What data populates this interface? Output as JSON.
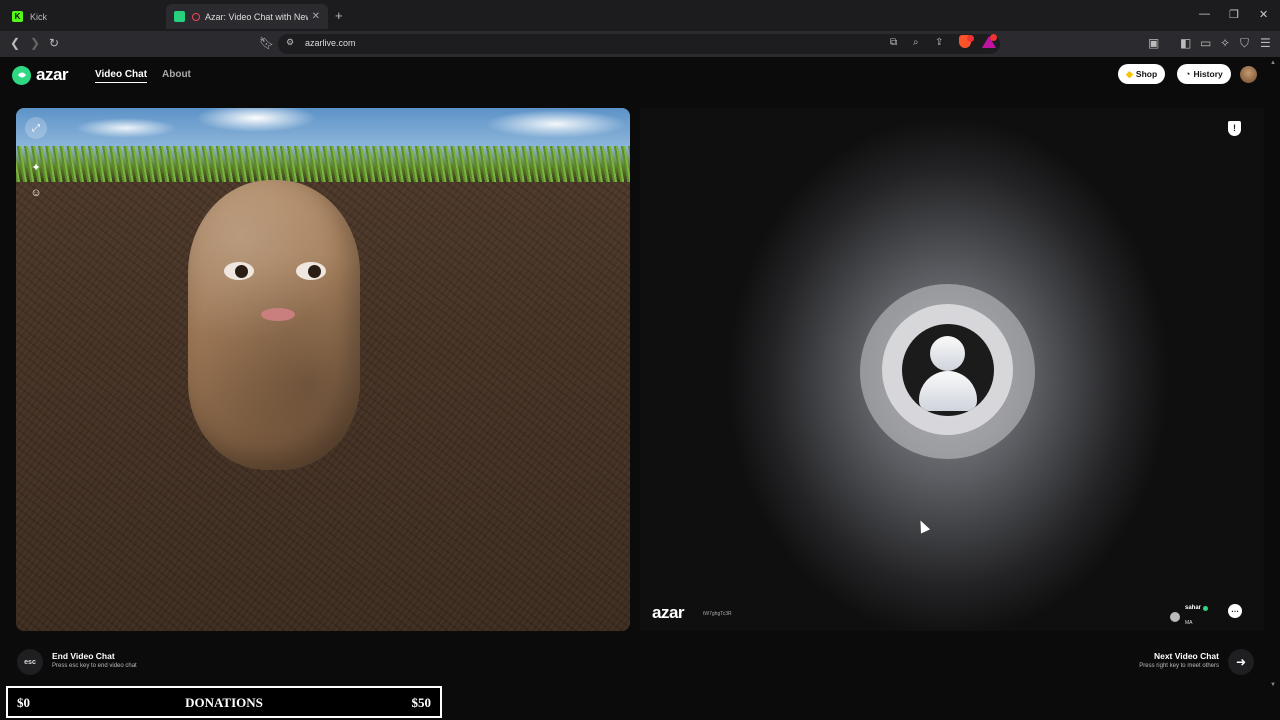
{
  "browser": {
    "tabs": [
      {
        "label": "Kick"
      },
      {
        "label": "Azar: Video Chat with New Pe"
      }
    ],
    "url": "azarlive.com"
  },
  "site": {
    "logo_text": "azar",
    "nav": {
      "video_chat": "Video Chat",
      "about": "About"
    },
    "shop_label": "Shop",
    "history_label": "History"
  },
  "remote": {
    "watermark": "azar",
    "watermark_id": "tW7ghgTc3R",
    "peer_name": "sahar",
    "peer_country": "MA"
  },
  "controls": {
    "esc_key": "esc",
    "end_title": "End Video Chat",
    "end_sub": "Press esc key to end video chat",
    "next_title": "Next Video Chat",
    "next_sub": "Press right key to meet others"
  },
  "donations": {
    "min": "$0",
    "label": "DONATIONS",
    "max": "$50"
  },
  "icons": {
    "brand_color": "#2fd882"
  }
}
